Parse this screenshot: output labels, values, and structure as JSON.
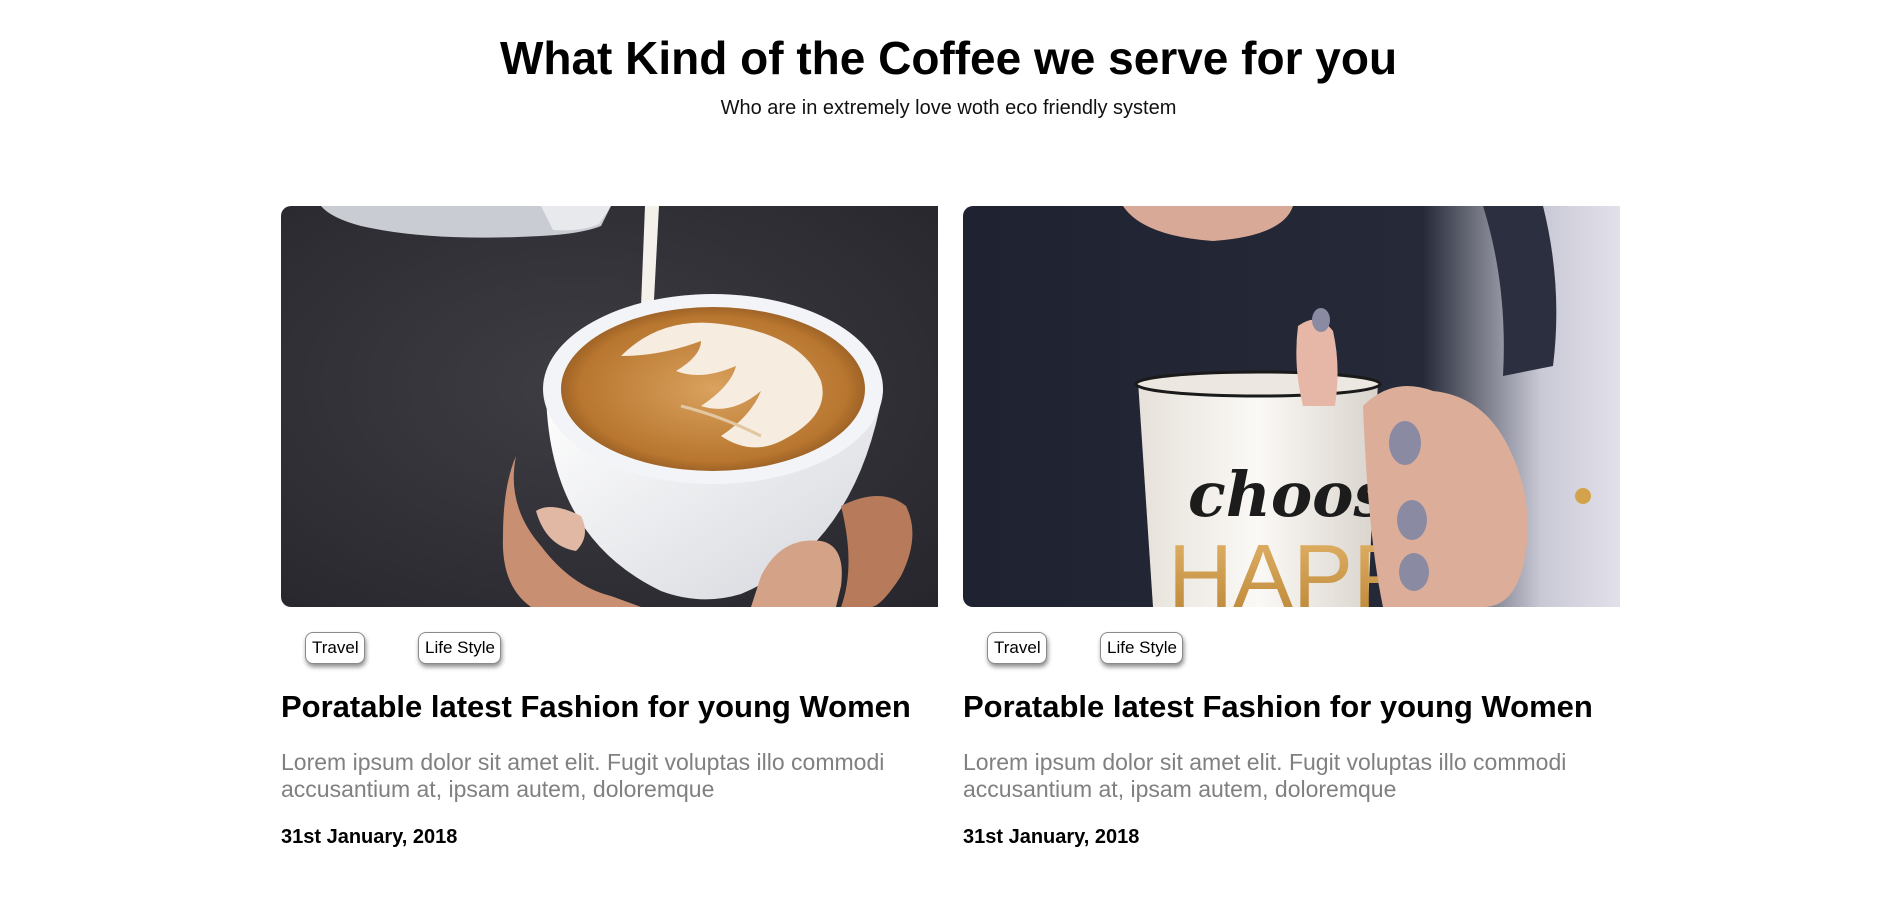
{
  "header": {
    "title": "What Kind of the Coffee we serve for you",
    "subtitle": "Who are in extremely love woth eco friendly system"
  },
  "cards": [
    {
      "image_alt": "Latte art being poured into a white cup",
      "tags": [
        "Travel",
        "Life Style"
      ],
      "title": "Poratable latest Fashion for young Women",
      "excerpt": "Lorem ipsum dolor sit amet elit. Fugit voluptas illo commodi accusantium at, ipsam autem, doloremque",
      "date": "31st January, 2018"
    },
    {
      "image_alt": "Hands holding a choose happy mug",
      "mug_text_top": "choose",
      "mug_text_bottom": "HAPPY",
      "tags": [
        "Travel",
        "Life Style"
      ],
      "title": "Poratable latest Fashion for young Women",
      "excerpt": "Lorem ipsum dolor sit amet elit. Fugit voluptas illo commodi accusantium at, ipsam autem, doloremque",
      "date": "31st January, 2018"
    }
  ],
  "colors": {
    "text": "#000000",
    "muted_text": "#808080",
    "background": "#ffffff",
    "coffee": "#c98a45",
    "shirt": "#2a2a30"
  }
}
